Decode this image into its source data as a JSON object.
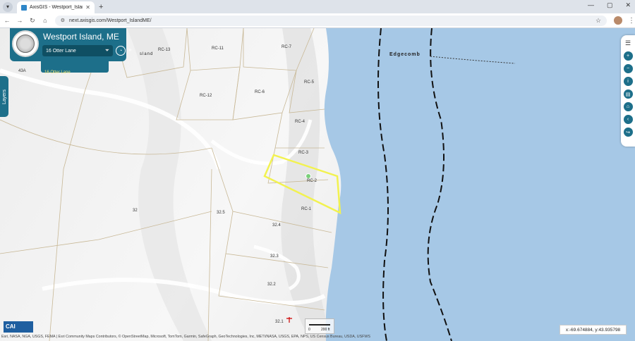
{
  "browser": {
    "tab_title": "AxisGIS - Westport_IslandME",
    "tab_close": "✕",
    "new_tab": "+",
    "url": "next.axisgis.com/Westport_IslandME/",
    "menu_icon": "chevron-down-icon",
    "window_controls": [
      "—",
      "▢",
      "✕"
    ]
  },
  "nav": {
    "back": "←",
    "forward": "→",
    "reload": "↻",
    "home": "⌂"
  },
  "app": {
    "town_title": "Westport Island, ME",
    "search_value": "16 Otter Lane",
    "result_item": "16 Otter Lane",
    "layers_label": "Layers"
  },
  "map": {
    "town_label": "Edgecomb",
    "town_label_partial": "sland",
    "parcels": [
      "RC-13",
      "RC-11",
      "RC-7",
      "43A",
      "RC-5",
      "RC-12",
      "RC-6",
      "RC-4",
      "RC-3",
      "RC-2",
      "RC-1",
      "32",
      "32.5",
      "32.4",
      "32.3",
      "32.2",
      "32.1"
    ],
    "coordinates": "x:-69.674884, y:43.935798",
    "scale_start": "0",
    "scale_end": "200 ft",
    "logo_text": "CAI",
    "attribution": "Esri, NASA, NGA, USGS, FEMA | Esri Community Maps Contributors, © OpenStreetMap, Microsoft, TomTom, Garmin, SafeGraph, GeoTechnologies, Inc, METI/NASA, USGS, EPA, NPS, US Census Bureau, USDA, USFWS",
    "water_color": "#a6c8e6",
    "land_color": "#f2f2f2",
    "parcel_line_color": "#c8b896",
    "highlight_color": "#f2f250"
  }
}
